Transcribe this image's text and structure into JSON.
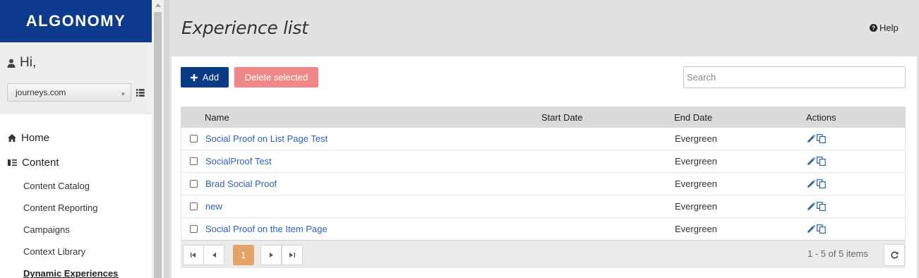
{
  "sidebar": {
    "logo": "ALGONOMY",
    "greeting": "Hi,",
    "site_select": "journeys.com",
    "nav": [
      {
        "label": "Home"
      },
      {
        "label": "Content"
      }
    ],
    "sub_items": [
      {
        "label": "Content Catalog"
      },
      {
        "label": "Content Reporting"
      },
      {
        "label": "Campaigns"
      },
      {
        "label": "Context Library"
      },
      {
        "label": "Dynamic Experiences"
      }
    ]
  },
  "header": {
    "title": "Experience list",
    "help_label": "Help"
  },
  "toolbar": {
    "add_label": "Add",
    "delete_label": "Delete selected",
    "search_placeholder": "Search"
  },
  "grid": {
    "columns": {
      "name": "Name",
      "start": "Start Date",
      "end": "End Date",
      "actions": "Actions"
    },
    "rows": [
      {
        "name": "Social Proof on List Page Test",
        "start": "",
        "end": "Evergreen"
      },
      {
        "name": "SocialProof Test",
        "start": "",
        "end": "Evergreen"
      },
      {
        "name": "Brad Social Proof",
        "start": "",
        "end": "Evergreen"
      },
      {
        "name": "new",
        "start": "",
        "end": "Evergreen"
      },
      {
        "name": "Social Proof on the Item Page",
        "start": "",
        "end": "Evergreen"
      }
    ]
  },
  "pager": {
    "current_page": "1",
    "info": "1 - 5 of 5 items"
  },
  "colors": {
    "brand": "#0d3a8c",
    "add_button": "#0a3a85",
    "delete_button": "#f0888a",
    "link": "#2c63b0",
    "pager_current": "#e3a46a"
  }
}
